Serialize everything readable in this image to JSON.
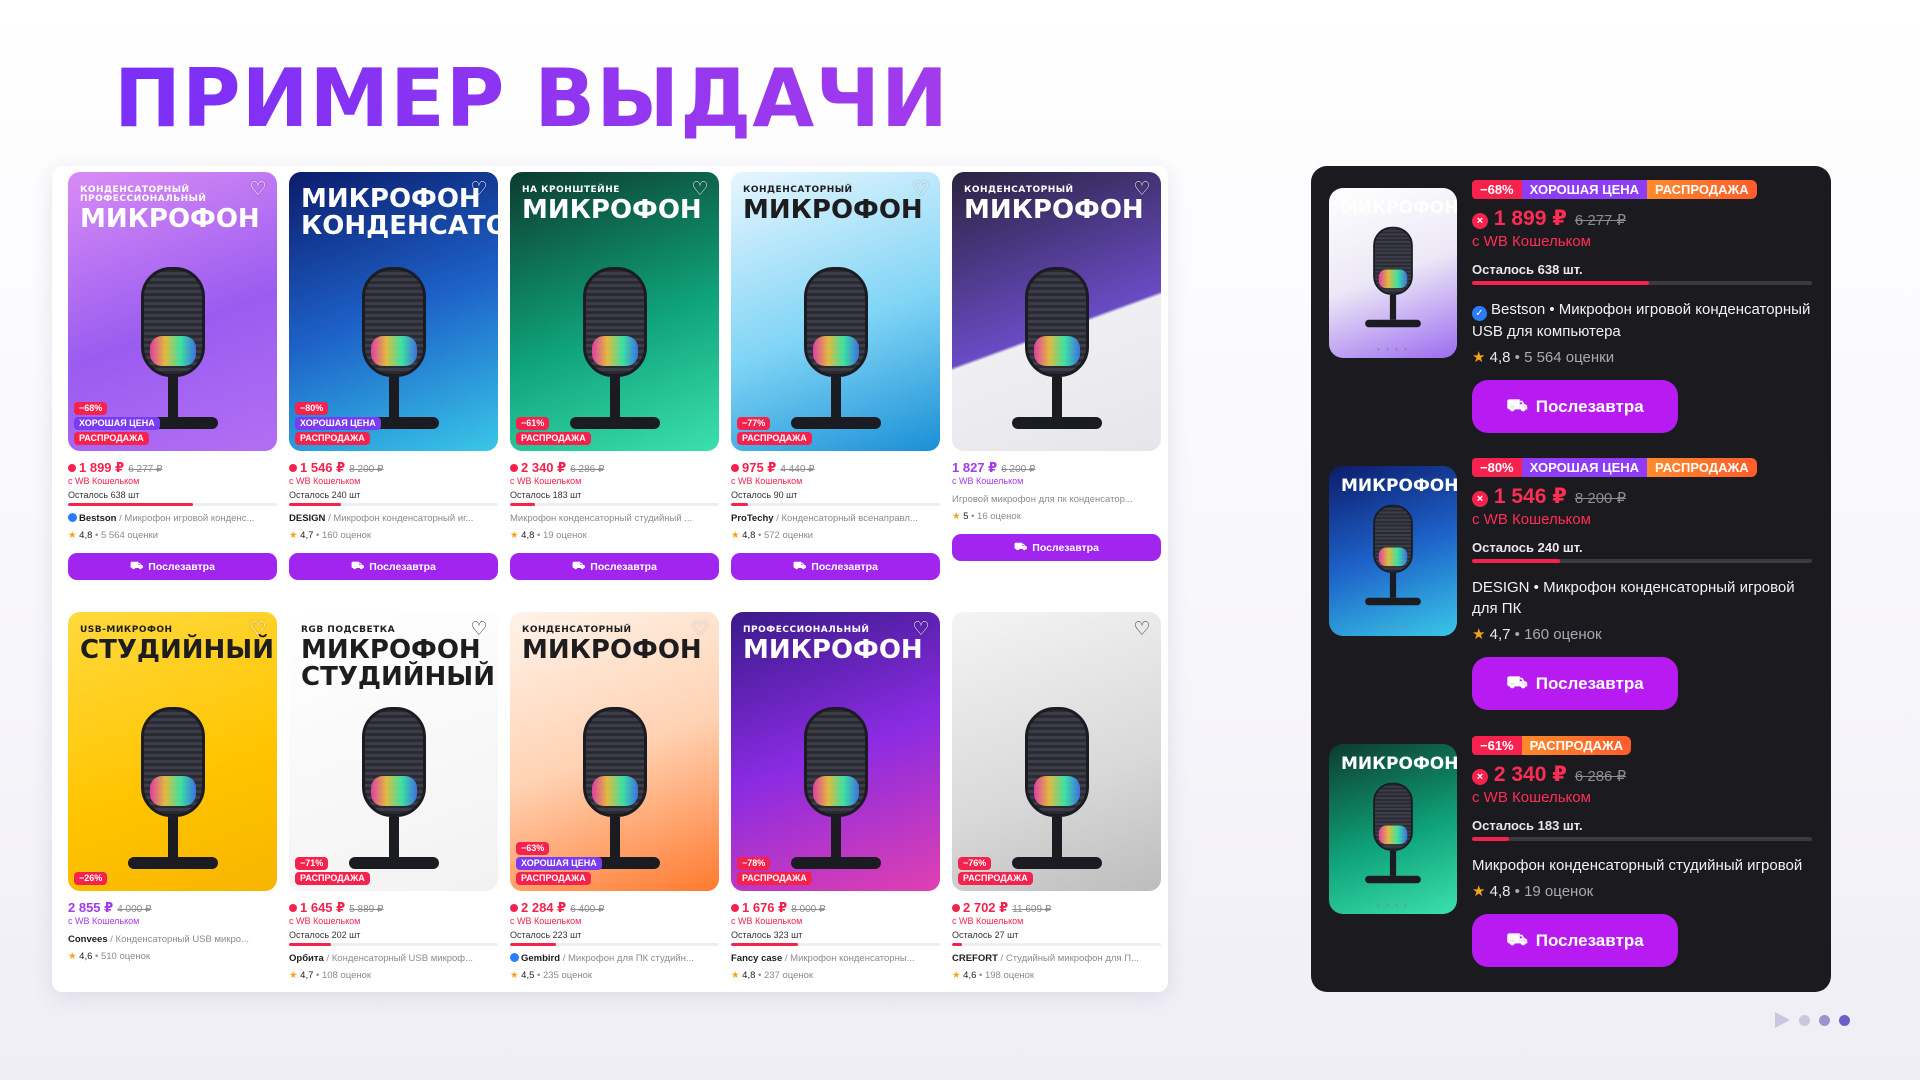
{
  "title": "ПРИМЕР ВЫДАЧИ",
  "grid_products": [
    {
      "img_small": "конденсаторный профессиональный",
      "img_big": "МИКРОФОН",
      "bg": "linear-gradient(160deg,#d98cf5,#9a5cf0 55%,#b36ff3)",
      "price": "1 899 ₽",
      "old_price": "6 277 ₽",
      "price_dot": true,
      "wallet": "с WB Кошельком",
      "stock": "Осталось 638 шт",
      "stock_fill": 0.6,
      "brand": "Bestson",
      "verified": true,
      "name": "Микрофон игровой конденс...",
      "rating": "4,8",
      "reviews": "5 564 оценки",
      "tags": [
        "−68%",
        "ХОРОШАЯ ЦЕНА",
        "РАСПРОДАЖА"
      ],
      "heart_dark": false
    },
    {
      "img_small": "",
      "img_big": "МИКРОФОН КОНДЕНСАТОРНЫЙ",
      "bg": "linear-gradient(160deg,#0c1c6b,#1d61c8 50%,#39c7e8)",
      "price": "1 546 ₽",
      "old_price": "8 200 ₽",
      "price_dot": true,
      "wallet": "с WB Кошельком",
      "stock": "Осталось 240 шт",
      "stock_fill": 0.25,
      "brand": "DESIGN",
      "verified": false,
      "name": "Микрофон конденсаторный иг...",
      "rating": "4,7",
      "reviews": "160 оценок",
      "tags": [
        "−80%",
        "ХОРОШАЯ ЦЕНА",
        "РАСПРОДАЖА"
      ],
      "heart_dark": false
    },
    {
      "img_small": "НА КРОНШТЕЙНЕ",
      "img_big": "МИКРОФОН",
      "bg": "linear-gradient(160deg,#0d3b2e,#0fa27a 55%,#3ce0b0)",
      "price": "2 340 ₽",
      "old_price": "6 286 ₽",
      "price_dot": true,
      "wallet": "с WB Кошельком",
      "stock": "Осталось 183 шт",
      "stock_fill": 0.12,
      "brand": "",
      "verified": false,
      "name": "Микрофон конденсаторный студийный ...",
      "rating": "4,8",
      "reviews": "19 оценок",
      "tags": [
        "−61%",
        "РАСПРОДАЖА"
      ],
      "heart_dark": false
    },
    {
      "img_small": "конденсаторный",
      "img_big": "МИКРОФОН",
      "bg": "linear-gradient(160deg,#e8f6ff,#7fd4f5 55%,#1a8fd6)",
      "price": "975 ₽",
      "old_price": "4 440 ₽",
      "price_dot": true,
      "wallet": "с WB Кошельком",
      "stock": "Осталось 90 шт",
      "stock_fill": 0.08,
      "brand": "ProTechy",
      "verified": false,
      "name": "Конденсаторный всенаправл...",
      "rating": "4,8",
      "reviews": "572 оценки",
      "tags": [
        "−77%",
        "РАСПРОДАЖА"
      ],
      "heart_dark": false
    },
    {
      "img_small": "конденсаторный",
      "img_big": "МИКРОФОН",
      "bg": "linear-gradient(160deg,#2a2340,#6a4bc4 55%,#efeff3 56%,#e6e6ea)",
      "price": "1 827 ₽",
      "old_price": "6 200 ₽",
      "price_dot": false,
      "wallet": "с WB Кошельком",
      "stock": "",
      "stock_fill": 0,
      "brand": "",
      "verified": false,
      "name": "Игровой микрофон для пк конденсатор...",
      "rating": "5",
      "reviews": "16 оценок",
      "tags": [],
      "heart_dark": false
    },
    {
      "img_small": "USB-МИКРОФОН",
      "img_big": "СТУДИЙНЫЙ",
      "bg": "linear-gradient(160deg,#ffd93d,#ffc400 60%,#f7b500)",
      "price": "2 855 ₽",
      "old_price": "4 000 ₽",
      "price_dot": false,
      "wallet": "с WB Кошельком",
      "stock": "",
      "stock_fill": 0,
      "brand": "Convees",
      "verified": false,
      "name": "Конденсаторный USB микро...",
      "rating": "4,6",
      "reviews": "510 оценок",
      "tags": [
        "−26%"
      ],
      "heart_dark": false
    },
    {
      "img_small": "RGB подсветка",
      "img_big": "Микрофон студийный",
      "bg": "linear-gradient(160deg,#ffffff,#f2f2f2)",
      "price": "1 645 ₽",
      "old_price": "5 889 ₽",
      "price_dot": true,
      "wallet": "с WB Кошельком",
      "stock": "Осталось 202 шт",
      "stock_fill": 0.2,
      "brand": "Орбита",
      "verified": false,
      "name": "Конденсаторный USB микроф...",
      "rating": "4,7",
      "reviews": "108 оценок",
      "tags": [
        "−71%",
        "РАСПРОДАЖА"
      ],
      "heart_dark": true
    },
    {
      "img_small": "конденсаторный",
      "img_big": "МИКРОФОН",
      "bg": "linear-gradient(160deg,#fff3ea,#ffd2b3 50%,#ff7a2f)",
      "price": "2 284 ₽",
      "old_price": "6 400 ₽",
      "price_dot": true,
      "wallet": "с WB Кошельком",
      "stock": "Осталось 223 шт",
      "stock_fill": 0.22,
      "brand": "Gembird",
      "verified": true,
      "name": "Микрофон для ПК студийн...",
      "rating": "4,5",
      "reviews": "235 оценок",
      "tags": [
        "−63%",
        "ХОРОШАЯ ЦЕНА",
        "РАСПРОДАЖА"
      ],
      "heart_dark": false
    },
    {
      "img_small": "ПРОФЕССИОНАЛЬНЫЙ",
      "img_big": "МИКРОФОН",
      "bg": "linear-gradient(160deg,#3a1a8a,#8a2be2 50%,#e040b0)",
      "price": "1 676 ₽",
      "old_price": "8 000 ₽",
      "price_dot": true,
      "wallet": "с WB Кошельком",
      "stock": "Осталось 323 шт",
      "stock_fill": 0.32,
      "brand": "Fancy case",
      "verified": false,
      "name": "Микрофон конденсаторны...",
      "rating": "4,8",
      "reviews": "237 оценок",
      "tags": [
        "−78%",
        "РАСПРОДАЖА"
      ],
      "heart_dark": false
    },
    {
      "img_small": "",
      "img_big": "",
      "bg": "linear-gradient(160deg,#f4f4f4,#d9d9d9 60%,#bdbdbd)",
      "price": "2 702 ₽",
      "old_price": "11 609 ₽",
      "price_dot": true,
      "wallet": "с WB Кошельком",
      "stock": "Осталось 27 шт",
      "stock_fill": 0.05,
      "brand": "CREFORT",
      "verified": false,
      "name": "Студийный микрофон для П...",
      "rating": "4,6",
      "reviews": "198 оценок",
      "tags": [
        "−76%",
        "РАСПРОДАЖА"
      ],
      "heart_dark": true
    }
  ],
  "buy_label": "Послезавтра",
  "dark_products": [
    {
      "badges": [
        "−68%",
        "ХОРОШАЯ ЦЕНА",
        "РАСПРОДАЖА"
      ],
      "price": "1 899 ₽",
      "old_price": "6 277 ₽",
      "wallet": "с WB Кошельком",
      "stock": "Осталось 638 шт.",
      "stock_fill": 0.52,
      "name": "Bestson • Микрофон игровой конденсаторный USB для компьютера",
      "verified": true,
      "rating": "4,8",
      "reviews": "5 564 оценки",
      "thumb_bg": "linear-gradient(160deg,#ffffff,#ece8f6 50%,#9c6cf0)",
      "thumb_text": "МИКРОФОН"
    },
    {
      "badges": [
        "−80%",
        "ХОРОШАЯ ЦЕНА",
        "РАСПРОДАЖА"
      ],
      "price": "1 546 ₽",
      "old_price": "8 200 ₽",
      "wallet": "с WB Кошельком",
      "stock": "Осталось 240 шт.",
      "stock_fill": 0.26,
      "name": "DESIGN • Микрофон конденсаторный игровой для ПК",
      "verified": false,
      "rating": "4,7",
      "reviews": "160 оценок",
      "thumb_bg": "linear-gradient(160deg,#0c1c6b,#1d61c8 50%,#39c7e8)",
      "thumb_text": "МИКРОФОН"
    },
    {
      "badges": [
        "−61%",
        "РАСПРОДАЖА"
      ],
      "price": "2 340 ₽",
      "old_price": "6 286 ₽",
      "wallet": "с WB Кошельком",
      "stock": "Осталось 183 шт.",
      "stock_fill": 0.11,
      "name": "Микрофон конденсаторный студийный игровой",
      "verified": false,
      "rating": "4,8",
      "reviews": "19 оценок",
      "thumb_bg": "linear-gradient(160deg,#0d3b2e,#0fa27a 55%,#3ce0b0)",
      "thumb_text": "МИКРОФОН"
    }
  ],
  "icons": {
    "heart": "heart-icon",
    "cart": "cart-icon",
    "star": "star-icon",
    "search": "image-search-icon"
  },
  "colors": {
    "accent": "#a224ef",
    "price_red": "#f5224e",
    "dark_bg": "#1b1b1f"
  }
}
